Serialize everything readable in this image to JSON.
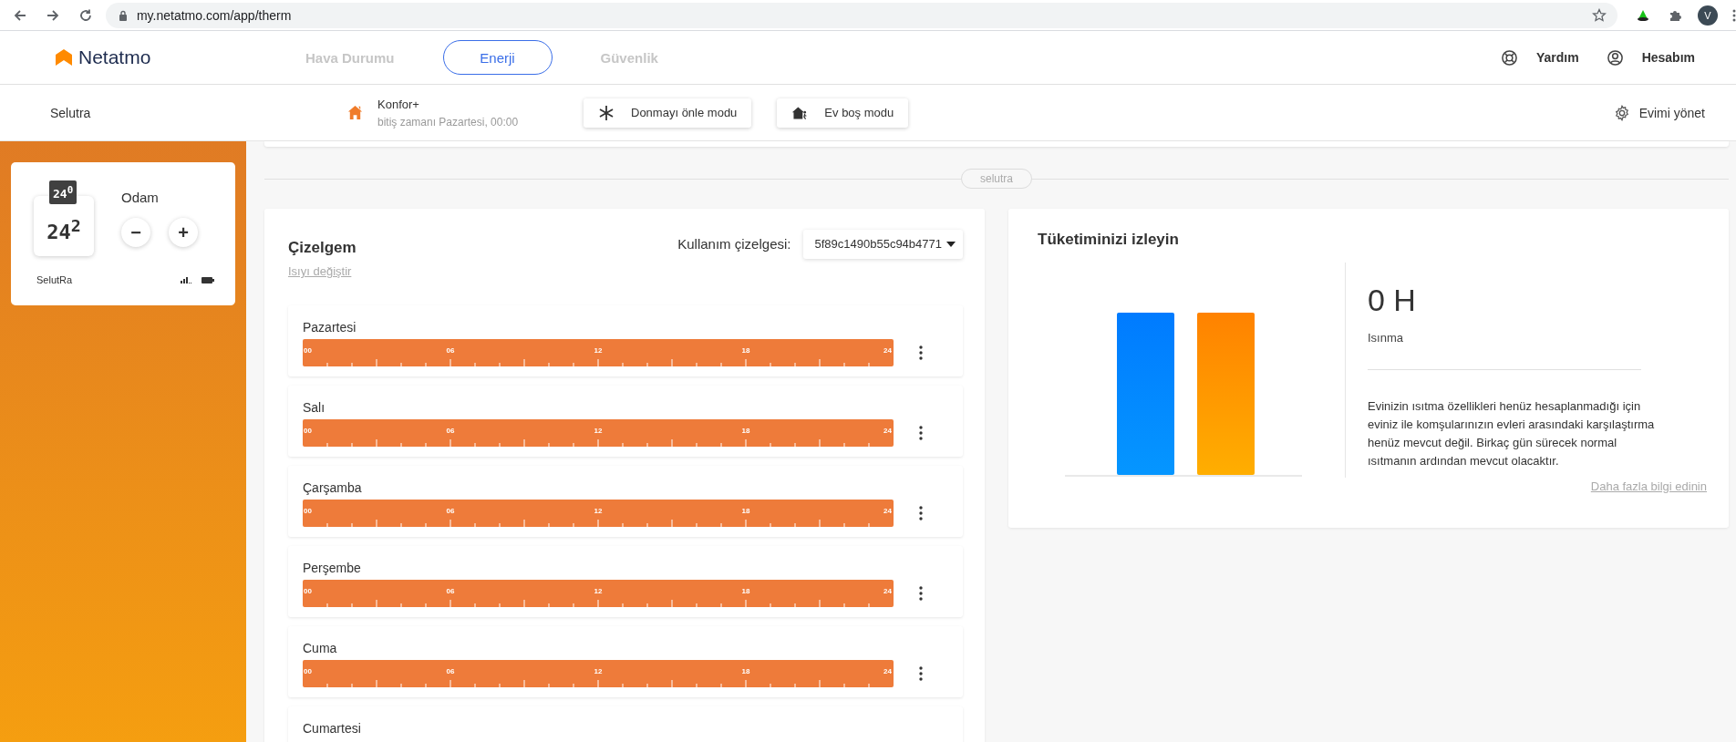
{
  "browser": {
    "url": "my.netatmo.com/app/therm",
    "profile_initial": "V"
  },
  "header": {
    "brand": "Netatmo",
    "tabs": [
      {
        "label": "Hava Durumu",
        "selected": false
      },
      {
        "label": "Enerji",
        "selected": true
      },
      {
        "label": "Güvenlik",
        "selected": false
      }
    ],
    "links": [
      {
        "kind": "help",
        "label": "Yardım"
      },
      {
        "kind": "account",
        "label": "Hesabım"
      }
    ]
  },
  "mode_bar": {
    "home": "Selutra",
    "mode": "Konfor+",
    "mode_until": "bitiş zamanı Pazartesi, 00:00",
    "buttons": [
      {
        "kind": "frost",
        "label": "Donmayı önle modu"
      },
      {
        "kind": "away",
        "label": "Ev boş modu"
      }
    ],
    "manage": "Evimi yönet"
  },
  "room_card": {
    "small_display": "24$^{0}$",
    "display": "24$^{2}$",
    "room": "Odam",
    "minus": "−",
    "plus": "+",
    "device": "SelutRa"
  },
  "divider_label": "selutra",
  "schedule": {
    "title": "Çizelgem",
    "link": "Isıyı değiştir",
    "select_label": "Kullanım çizelgesi:",
    "select_value": "5f89c1490b55c94b4771",
    "days": [
      {
        "name": "Pazartesi",
        "hour_labels": [
          "00",
          "06",
          "12",
          "18",
          "24"
        ]
      },
      {
        "name": "Salı",
        "hour_labels": [
          "00",
          "06",
          "12",
          "18",
          "24"
        ]
      },
      {
        "name": "Çarşamba",
        "hour_labels": [
          "00",
          "06",
          "12",
          "18",
          "24"
        ]
      },
      {
        "name": "Perşembe",
        "hour_labels": [
          "00",
          "06",
          "12",
          "18",
          "24"
        ]
      },
      {
        "name": "Cuma",
        "hour_labels": [
          "00",
          "06",
          "12",
          "18",
          "24"
        ]
      },
      {
        "name": "Cumartesi"
      }
    ]
  },
  "consumption": {
    "title": "Tüketiminizi izleyin",
    "value": "0 H",
    "value_label": "Isınma",
    "text": "Evinizin ısıtma özellikleri henüz hesaplanmadığı için eviniz ile komşularınızın evleri arasındaki karşılaştırma henüz mevcut değil. Birkaç gün sürecek normal ısıtmanın ardından mevcut olacaktır.",
    "link": "Daha fazla bilgi edinin"
  }
}
